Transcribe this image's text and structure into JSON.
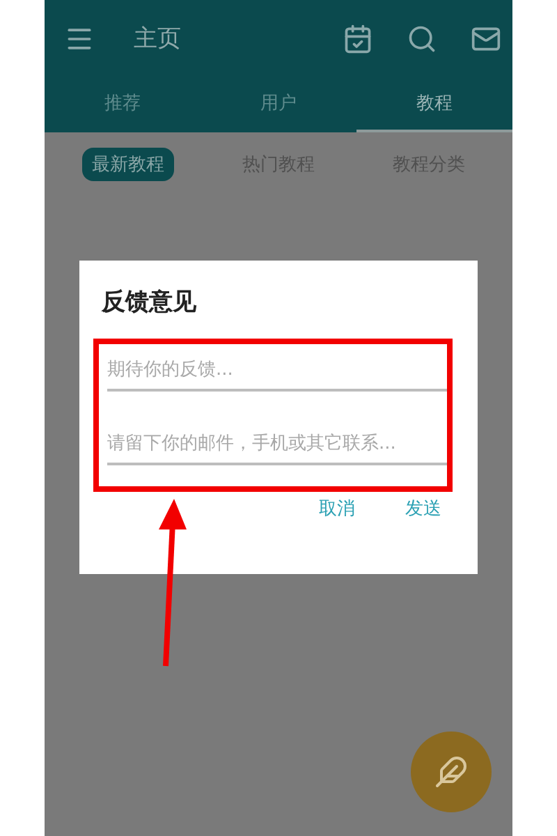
{
  "app_bar": {
    "title": "主页"
  },
  "tabs": [
    {
      "label": "推荐",
      "selected": false
    },
    {
      "label": "用户",
      "selected": false
    },
    {
      "label": "教程",
      "selected": true
    }
  ],
  "sub_tabs": [
    {
      "label": "最新教程",
      "selected": true
    },
    {
      "label": "热门教程",
      "selected": false
    },
    {
      "label": "教程分类",
      "selected": false
    }
  ],
  "dialog": {
    "title": "反馈意见",
    "fields": [
      {
        "placeholder": "期待你的反馈..."
      },
      {
        "placeholder": "请留下你的邮件，手机或其它联系..."
      }
    ],
    "buttons": [
      "取消",
      "发送"
    ]
  }
}
